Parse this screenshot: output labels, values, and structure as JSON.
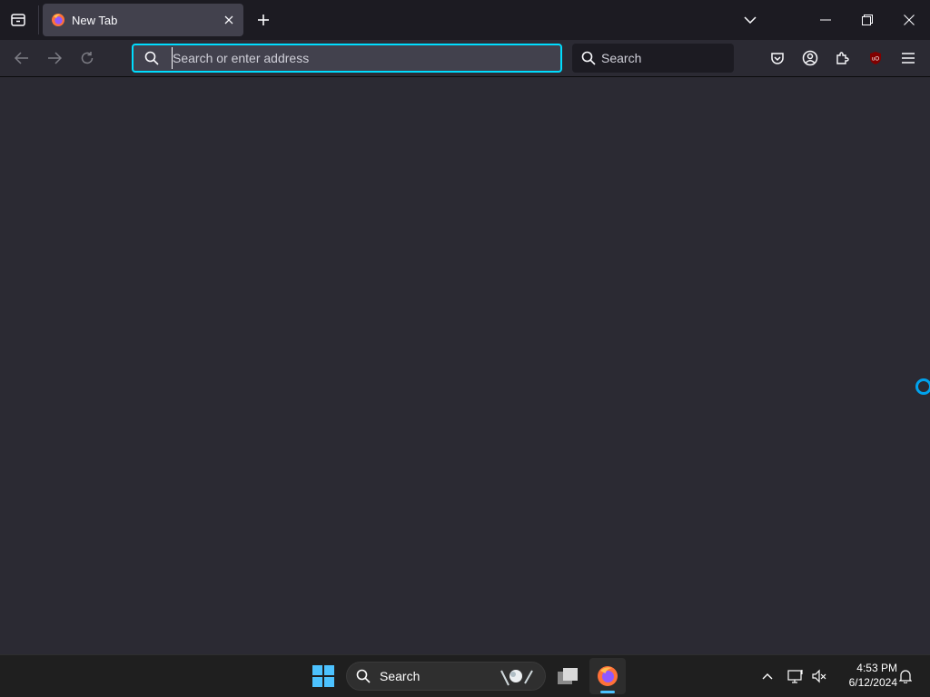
{
  "browser": {
    "tab": {
      "title": "New Tab"
    },
    "urlbar": {
      "placeholder": "Search or enter address",
      "value": ""
    },
    "searchbar": {
      "placeholder": "Search"
    }
  },
  "taskbar": {
    "search_label": "Search",
    "clock": {
      "time": "4:53 PM",
      "date": "6/12/2024"
    }
  },
  "colors": {
    "accent": "#00ddff",
    "tab_active": "#42414d",
    "toolbar": "#2b2a33",
    "tabstrip": "#1c1b22",
    "taskbar": "#1f1f1f"
  },
  "icons": {
    "tab_list": "tab-list-icon",
    "favicon": "firefox-icon",
    "tab_close": "close-icon",
    "new_tab": "plus-icon",
    "list_all_tabs": "chevron-down-icon",
    "minimize": "minimize-icon",
    "restore": "restore-icon",
    "close_window": "close-icon",
    "back": "back-arrow-icon",
    "forward": "forward-arrow-icon",
    "reload": "reload-icon",
    "search": "search-icon",
    "pocket": "pocket-icon",
    "account": "account-icon",
    "extensions": "puzzle-icon",
    "ublock": "ublock-origin-icon",
    "menu": "hamburger-menu-icon",
    "start": "windows-start-icon",
    "file_explorer": "file-explorer-icon",
    "firefox_taskbar": "firefox-icon",
    "tray_chevron": "chevron-up-icon",
    "network": "network-icon",
    "volume": "volume-muted-icon",
    "notifications": "bell-icon"
  }
}
